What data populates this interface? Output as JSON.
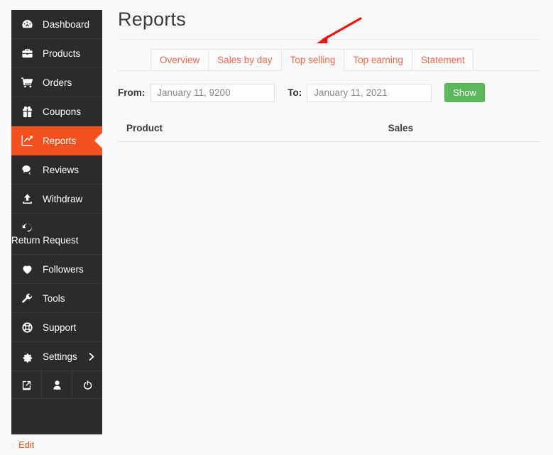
{
  "sidebar": {
    "items": [
      {
        "label": "Dashboard",
        "icon": "dashboard-icon",
        "active": false
      },
      {
        "label": "Products",
        "icon": "briefcase-icon",
        "active": false
      },
      {
        "label": "Orders",
        "icon": "cart-icon",
        "active": false
      },
      {
        "label": "Coupons",
        "icon": "gift-icon",
        "active": false
      },
      {
        "label": "Reports",
        "icon": "chart-line-icon",
        "active": true
      },
      {
        "label": "Reviews",
        "icon": "comments-icon",
        "active": false
      },
      {
        "label": "Withdraw",
        "icon": "upload-icon",
        "active": false
      },
      {
        "label": "Return Request",
        "icon": "undo-icon",
        "active": false
      },
      {
        "label": "Followers",
        "icon": "heart-icon",
        "active": false
      },
      {
        "label": "Tools",
        "icon": "wrench-icon",
        "active": false
      },
      {
        "label": "Support",
        "icon": "lifebuoy-icon",
        "active": false
      },
      {
        "label": "Settings",
        "icon": "gear-icon",
        "active": false,
        "chevron": "chevron-right-icon"
      }
    ],
    "bottom_icons": [
      {
        "name": "external-link-icon"
      },
      {
        "name": "user-icon"
      },
      {
        "name": "power-icon"
      }
    ],
    "edit_link": "Edit"
  },
  "header": {
    "title": "Reports"
  },
  "tabs": [
    {
      "label": "Overview",
      "active": false
    },
    {
      "label": "Sales by day",
      "active": false
    },
    {
      "label": "Top selling",
      "active": true
    },
    {
      "label": "Top earning",
      "active": false
    },
    {
      "label": "Statement",
      "active": false
    }
  ],
  "filters": {
    "from_label": "From:",
    "from_value": "January 11, 9200",
    "to_label": "To:",
    "to_value": "January 11, 2021",
    "submit_label": "Show"
  },
  "table": {
    "columns": [
      "Product",
      "Sales"
    ],
    "rows": []
  },
  "annotation": {
    "type": "arrow",
    "color": "#ee1111",
    "points_to": "Top selling"
  },
  "colors": {
    "sidebar_bg": "#2b2b2b",
    "accent": "#f4511e",
    "tab_text": "#f4674a",
    "button_green": "#5cb85c",
    "page_bg": "#f9f9f9"
  }
}
